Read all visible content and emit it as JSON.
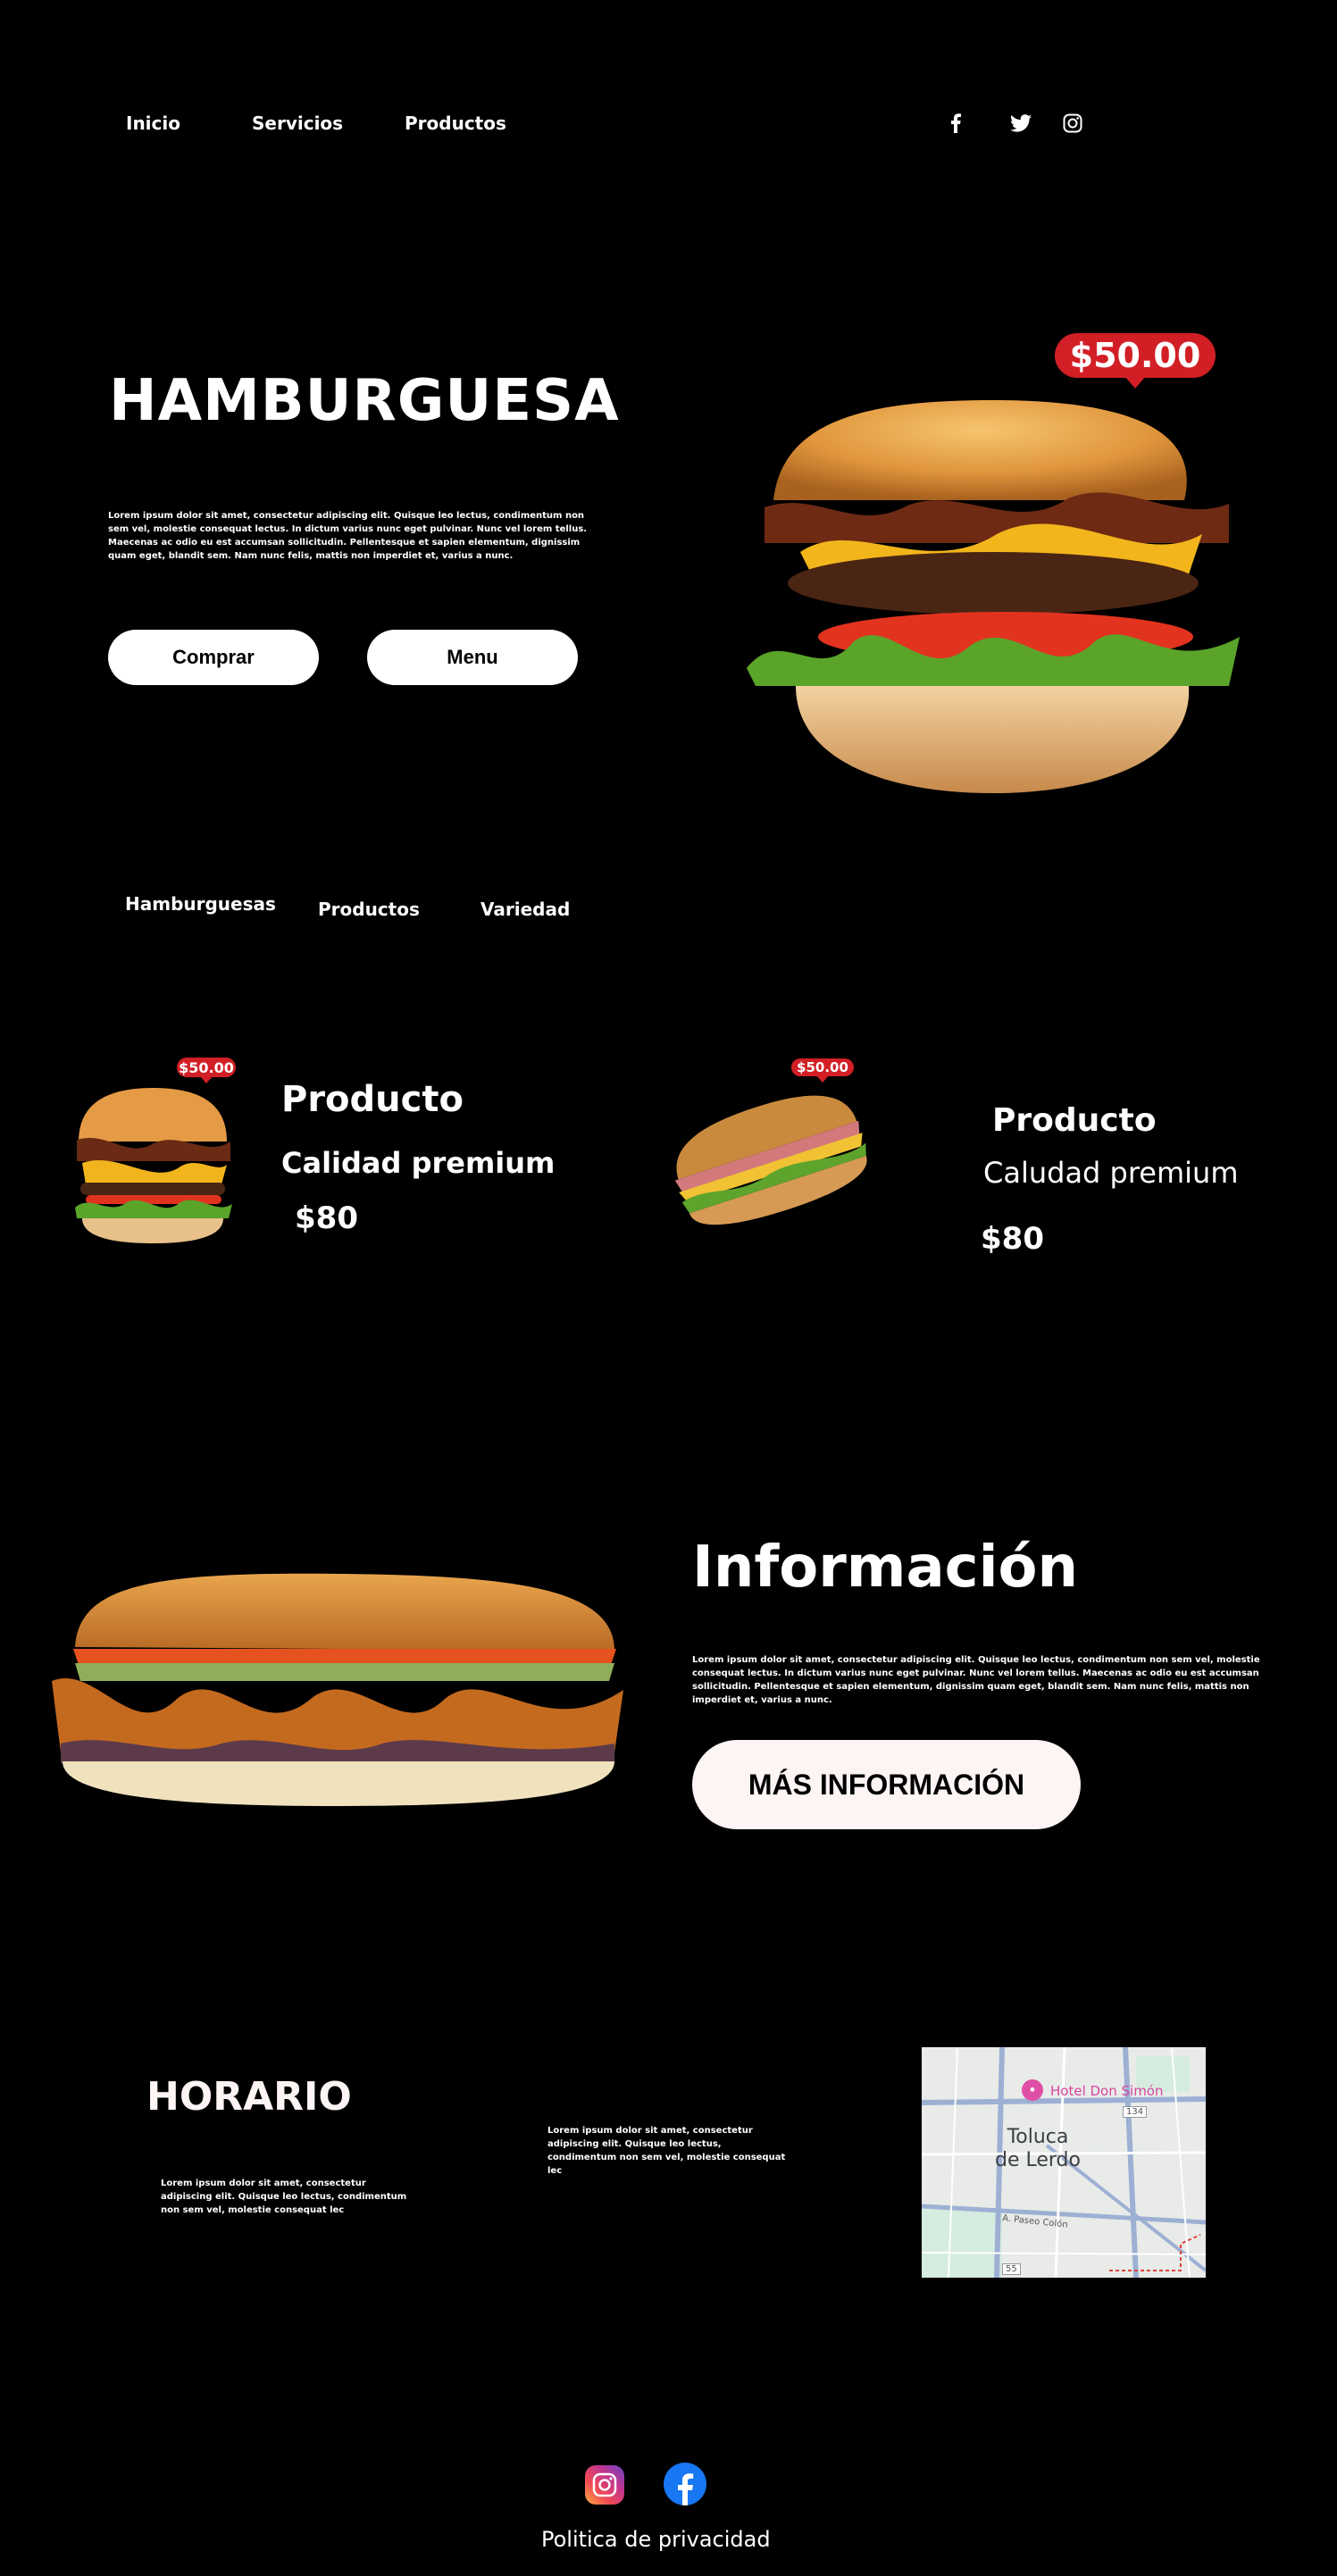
{
  "nav": {
    "items": [
      "Inicio",
      "Servicios",
      "Productos"
    ]
  },
  "hero": {
    "title": "HAMBURGUESA",
    "description": "Lorem ipsum dolor sit amet, consectetur adipiscing elit. Quisque leo lectus, condimentum non sem vel, molestie consequat lectus. In dictum varius nunc eget pulvinar. Nunc vel lorem tellus. Maecenas ac odio eu est accumsan sollicitudin. Pellentesque et sapien elementum, dignissim quam eget, blandit sem. Nam nunc felis, mattis non imperdiet et, varius a nunc.",
    "buy_label": "Comprar",
    "menu_label": "Menu",
    "price": "$50.00"
  },
  "categories": [
    "Hamburguesas",
    "Productos",
    "Variedad"
  ],
  "products": [
    {
      "badge": "$50.00",
      "name": "Producto",
      "subtitle": "Calidad premium",
      "price": "$80"
    },
    {
      "badge": "$50.00",
      "name": "Producto",
      "subtitle": "Caludad premium",
      "price": "$80"
    }
  ],
  "info": {
    "title": "Información",
    "description": "Lorem ipsum dolor sit amet, consectetur adipiscing elit. Quisque leo lectus, condimentum non sem vel, molestie consequat lectus. In dictum varius nunc eget pulvinar. Nunc vel lorem tellus. Maecenas ac odio eu est accumsan sollicitudin. Pellentesque et sapien elementum, dignissim quam eget, blandit sem. Nam nunc felis, mattis non imperdiet et, varius a nunc.",
    "button_label": "MÁS INFORMACIÓN"
  },
  "schedule": {
    "title": "HORARIO",
    "text_left": "Lorem ipsum dolor sit amet, consectetur adipiscing elit. Quisque leo lectus, condimentum non sem vel, molestie consequat lec",
    "text_center": "Lorem ipsum dolor sit amet, consectetur adipiscing elit. Quisque leo lectus, condimentum non sem vel, molestie consequat lec"
  },
  "map": {
    "poi": "Hotel Don Simón",
    "city": "Toluca\nde Lerdo",
    "road_134": "134",
    "road_55": "55",
    "street": "A. Paseo Colón"
  },
  "footer": {
    "privacy": "Politica de privacidad"
  },
  "colors": {
    "background": "#000000",
    "price_red": "#d21f26",
    "button_white": "#ffffff",
    "info_button": "#fdf4f4"
  }
}
